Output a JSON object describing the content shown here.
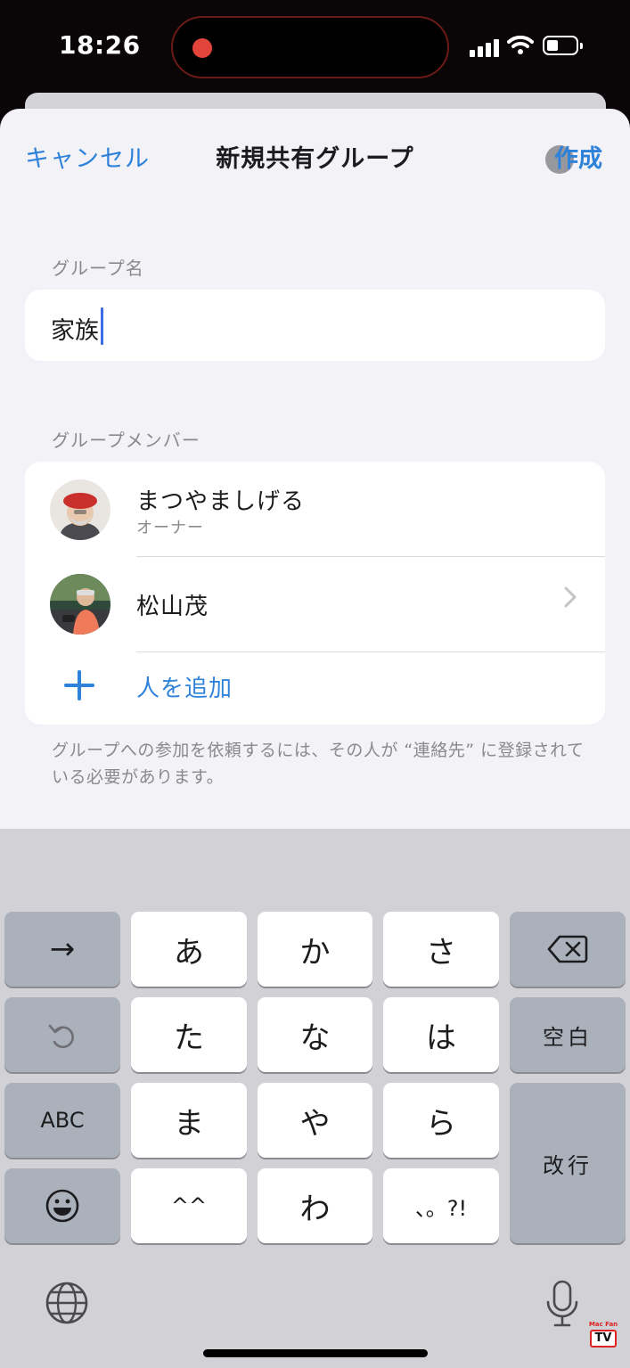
{
  "status_bar": {
    "time": "18:26"
  },
  "nav": {
    "cancel": "キャンセル",
    "title": "新規共有グループ",
    "create": "作成"
  },
  "group_name": {
    "label": "グループ名",
    "value": "家族"
  },
  "members": {
    "label": "グループメンバー",
    "items": [
      {
        "name": "まつやましげる",
        "role": "オーナー"
      },
      {
        "name": "松山茂"
      }
    ],
    "add_label": "人を追加"
  },
  "footnote": "グループへの参加を依頼するには、その人が “連絡先” に登録されている必要があります。",
  "keyboard": {
    "row1": [
      "→",
      "あ",
      "か",
      "さ"
    ],
    "row2_labels": [
      "た",
      "な",
      "は",
      "空白"
    ],
    "row3": [
      "ABC",
      "ま",
      "や",
      "ら",
      "改行"
    ],
    "row4": [
      "^^",
      "わ",
      "、。?!"
    ]
  },
  "icons": {
    "backspace": "backspace-icon",
    "undo": "undo-icon",
    "emoji": "emoji-icon",
    "globe": "globe-icon",
    "mic": "microphone-icon",
    "plus": "plus-icon",
    "chevron": "chevron-right-icon"
  },
  "watermark": {
    "brand": "Mac Fan",
    "tv": "TV"
  },
  "colors": {
    "accent": "#2f82d9",
    "background": "#f2f2f7",
    "keyboard": "#d1d1d6"
  }
}
